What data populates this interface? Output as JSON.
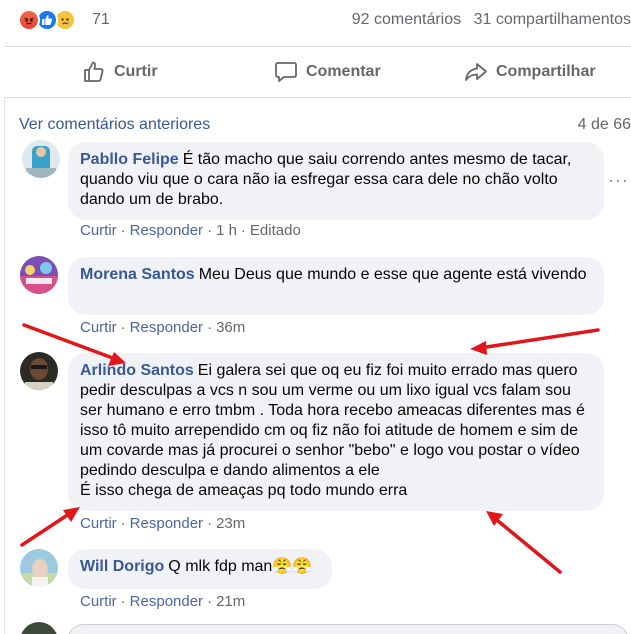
{
  "reactions": {
    "icons": [
      "angry-icon",
      "like-icon",
      "sad-icon"
    ],
    "count": "71"
  },
  "stats": {
    "comments": "92 comentários",
    "shares": "31 compartilhamentos"
  },
  "actions": {
    "like": "Curtir",
    "comment": "Comentar",
    "share": "Compartilhar"
  },
  "previous": {
    "link": "Ver comentários anteriores",
    "count": "4 de 66"
  },
  "comments": [
    {
      "author": "Pabllo Felipe",
      "text": "É tão macho que saiu correndo antes mesmo de tacar, quando viu que o cara não ia esfregar essa cara dele no chão volto dando um de brabo.",
      "like": "Curtir",
      "reply": "Responder",
      "time": "1 h",
      "edited": "Editado"
    },
    {
      "author": "Morena Santos",
      "text": "Meu Deus que mundo e esse que agente está vivendo",
      "like": "Curtir",
      "reply": "Responder",
      "time": "36m"
    },
    {
      "author": "Arlindo Santos",
      "text": "Ei galera sei que oq eu fiz foi muito errado mas quero pedir desculpas a vcs n sou um verme ou um lixo igual vcs falam sou ser humano e erro tmbm . Toda hora recebo ameacas diferentes mas é isso tô muito arrependido cm oq fiz não foi atitude de homem e sim de um covarde mas já procurei o senhor \"bebo\" e logo vou postar o vídeo pedindo desculpa e dando alimentos a ele",
      "text2": "É isso chega de ameaças pq todo mundo erra",
      "like": "Curtir",
      "reply": "Responder",
      "time": "23m"
    },
    {
      "author": "Will Dorigo",
      "text": "Q mlk fdp man😤😤",
      "like": "Curtir",
      "reply": "Responder",
      "time": "21m"
    }
  ],
  "colors": {
    "author": "#385898",
    "bubble": "#f0f2f5",
    "muted": "#65676b",
    "arrow": "#e0161b"
  }
}
